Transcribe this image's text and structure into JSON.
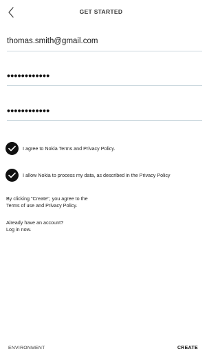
{
  "header": {
    "title": "GET STARTED",
    "back_icon": "chevron-left-icon"
  },
  "form": {
    "email_value": "thomas.smith@gmail.com",
    "password_mask": "••••••••••••",
    "password_confirm_mask": "••••••••••••"
  },
  "consents": [
    {
      "label": "I agree to Nokia Terms and Privacy Policy.",
      "checked": true
    },
    {
      "label": "I allow Nokia to process my data, as described in the Privacy Policy",
      "checked": true
    }
  ],
  "notes": {
    "create_line1": "By clicking \"Create\", you agree to the",
    "create_line2": "Terms of use and Privacy Policy.",
    "account_line1": "Already have an account?",
    "account_line2": "Log in now."
  },
  "footer": {
    "environment_label": "ENVIRONMENT",
    "create_label": "CREATE"
  },
  "colors": {
    "check_fill": "#111111",
    "divider": "#c9d6dd"
  }
}
